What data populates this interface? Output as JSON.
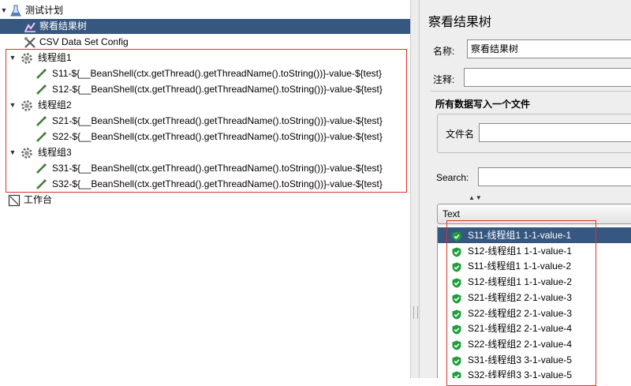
{
  "tree": {
    "root_label": "测试计划",
    "view_results_tree": "察看结果树",
    "csv_config": "CSV Data Set Config",
    "groups": [
      {
        "label": "线程组1",
        "samplers": [
          "S11-${__BeanShell(ctx.getThread().getThreadName().toString())}-value-${test}",
          "S12-${__BeanShell(ctx.getThread().getThreadName().toString())}-value-${test}"
        ]
      },
      {
        "label": "线程组2",
        "samplers": [
          "S21-${__BeanShell(ctx.getThread().getThreadName().toString())}-value-${test}",
          "S22-${__BeanShell(ctx.getThread().getThreadName().toString())}-value-${test}"
        ]
      },
      {
        "label": "线程组3",
        "samplers": [
          "S31-${__BeanShell(ctx.getThread().getThreadName().toString())}-value-${test}",
          "S32-${__BeanShell(ctx.getThread().getThreadName().toString())}-value-${test}"
        ]
      }
    ],
    "workbench": "工作台"
  },
  "panel": {
    "title": "察看结果树",
    "name_label": "名称:",
    "name_value": "察看结果树",
    "comment_label": "注释:",
    "comment_value": "",
    "file_section_title": "所有数据写入一个文件",
    "filename_label": "文件名",
    "filename_value": "",
    "search_label": "Search:",
    "search_value": "",
    "view_mode": "Text"
  },
  "results": [
    "S11-线程组1 1-1-value-1",
    "S12-线程组1 1-1-value-1",
    "S11-线程组1 1-1-value-2",
    "S12-线程组1 1-1-value-2",
    "S21-线程组2 2-1-value-3",
    "S22-线程组2 2-1-value-3",
    "S21-线程组2 2-1-value-4",
    "S22-线程组2 2-1-value-4",
    "S31-线程组3 3-1-value-5",
    "S32-线程组3 3-1-value-5"
  ],
  "colors": {
    "selection": "#36577f",
    "highlight_box": "#e0302a",
    "success": "#1f9e3a"
  }
}
